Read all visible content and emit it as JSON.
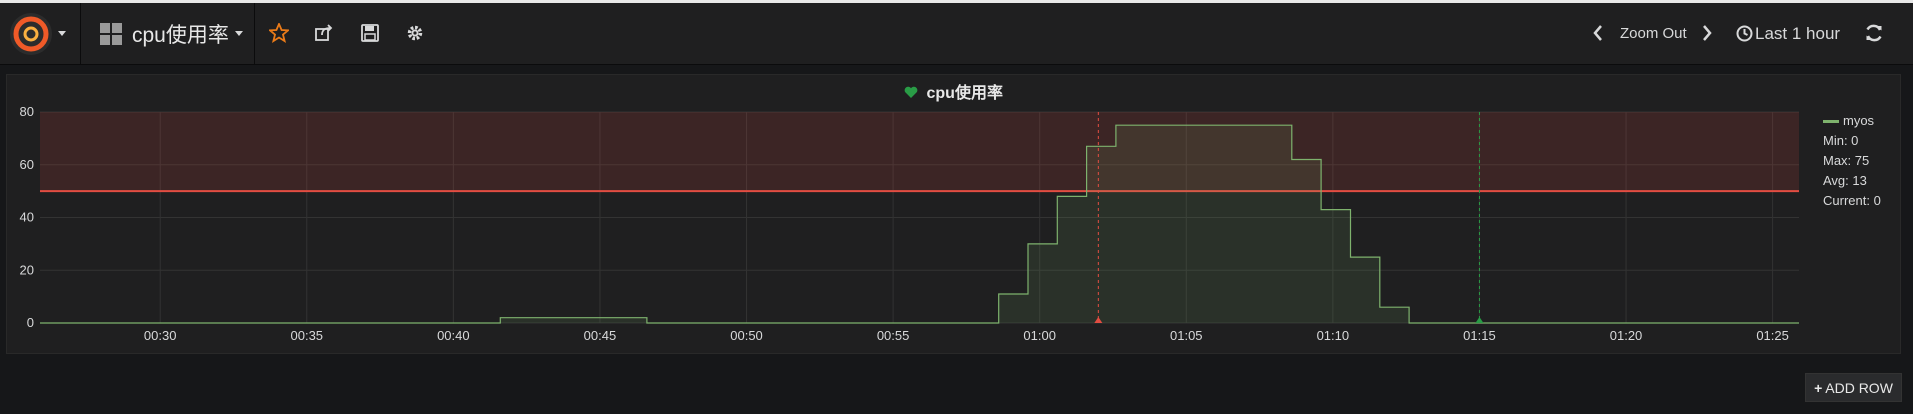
{
  "header": {
    "dashboard_title": "cpu使用率",
    "zoom_out_label": "Zoom Out",
    "time_range_label": "Last 1 hour"
  },
  "panel": {
    "title": "cpu使用率",
    "legend": {
      "series_name": "myos",
      "min": "Min: 0",
      "max": "Max: 75",
      "avg": "Avg: 13",
      "current": "Current: 0"
    }
  },
  "actions": {
    "add_row_label": "ADD ROW"
  },
  "colors": {
    "series": "#7eb26d",
    "threshold": "#e24d42",
    "accent": "#eb7b18",
    "heart": "#299c46"
  },
  "chart_data": {
    "type": "area",
    "title": "cpu使用率",
    "xlabel": "",
    "ylabel": "",
    "ylim": [
      0,
      80
    ],
    "yticks": [
      0,
      20,
      40,
      60,
      80
    ],
    "x_tick_labels": [
      "00:30",
      "00:35",
      "00:40",
      "00:45",
      "00:50",
      "00:55",
      "01:00",
      "01:05",
      "01:10",
      "01:15",
      "01:20",
      "01:25"
    ],
    "x_range_minutes": [
      25.9,
      85.9
    ],
    "threshold": 50,
    "annotations_minutes": [
      62,
      75
    ],
    "series": [
      {
        "name": "myos",
        "points": [
          [
            25.9,
            0
          ],
          [
            41.6,
            0
          ],
          [
            41.6,
            2
          ],
          [
            46.6,
            2
          ],
          [
            46.6,
            0
          ],
          [
            58.6,
            0
          ],
          [
            58.6,
            11
          ],
          [
            59.6,
            11
          ],
          [
            59.6,
            30
          ],
          [
            60.6,
            30
          ],
          [
            60.6,
            48
          ],
          [
            61.6,
            48
          ],
          [
            61.6,
            67
          ],
          [
            62.6,
            67
          ],
          [
            62.6,
            75
          ],
          [
            68.6,
            75
          ],
          [
            68.6,
            62
          ],
          [
            69.6,
            62
          ],
          [
            69.6,
            43
          ],
          [
            70.6,
            43
          ],
          [
            70.6,
            25
          ],
          [
            71.6,
            25
          ],
          [
            71.6,
            6
          ],
          [
            72.6,
            6
          ],
          [
            72.6,
            0
          ],
          [
            85.9,
            0
          ]
        ]
      }
    ]
  }
}
